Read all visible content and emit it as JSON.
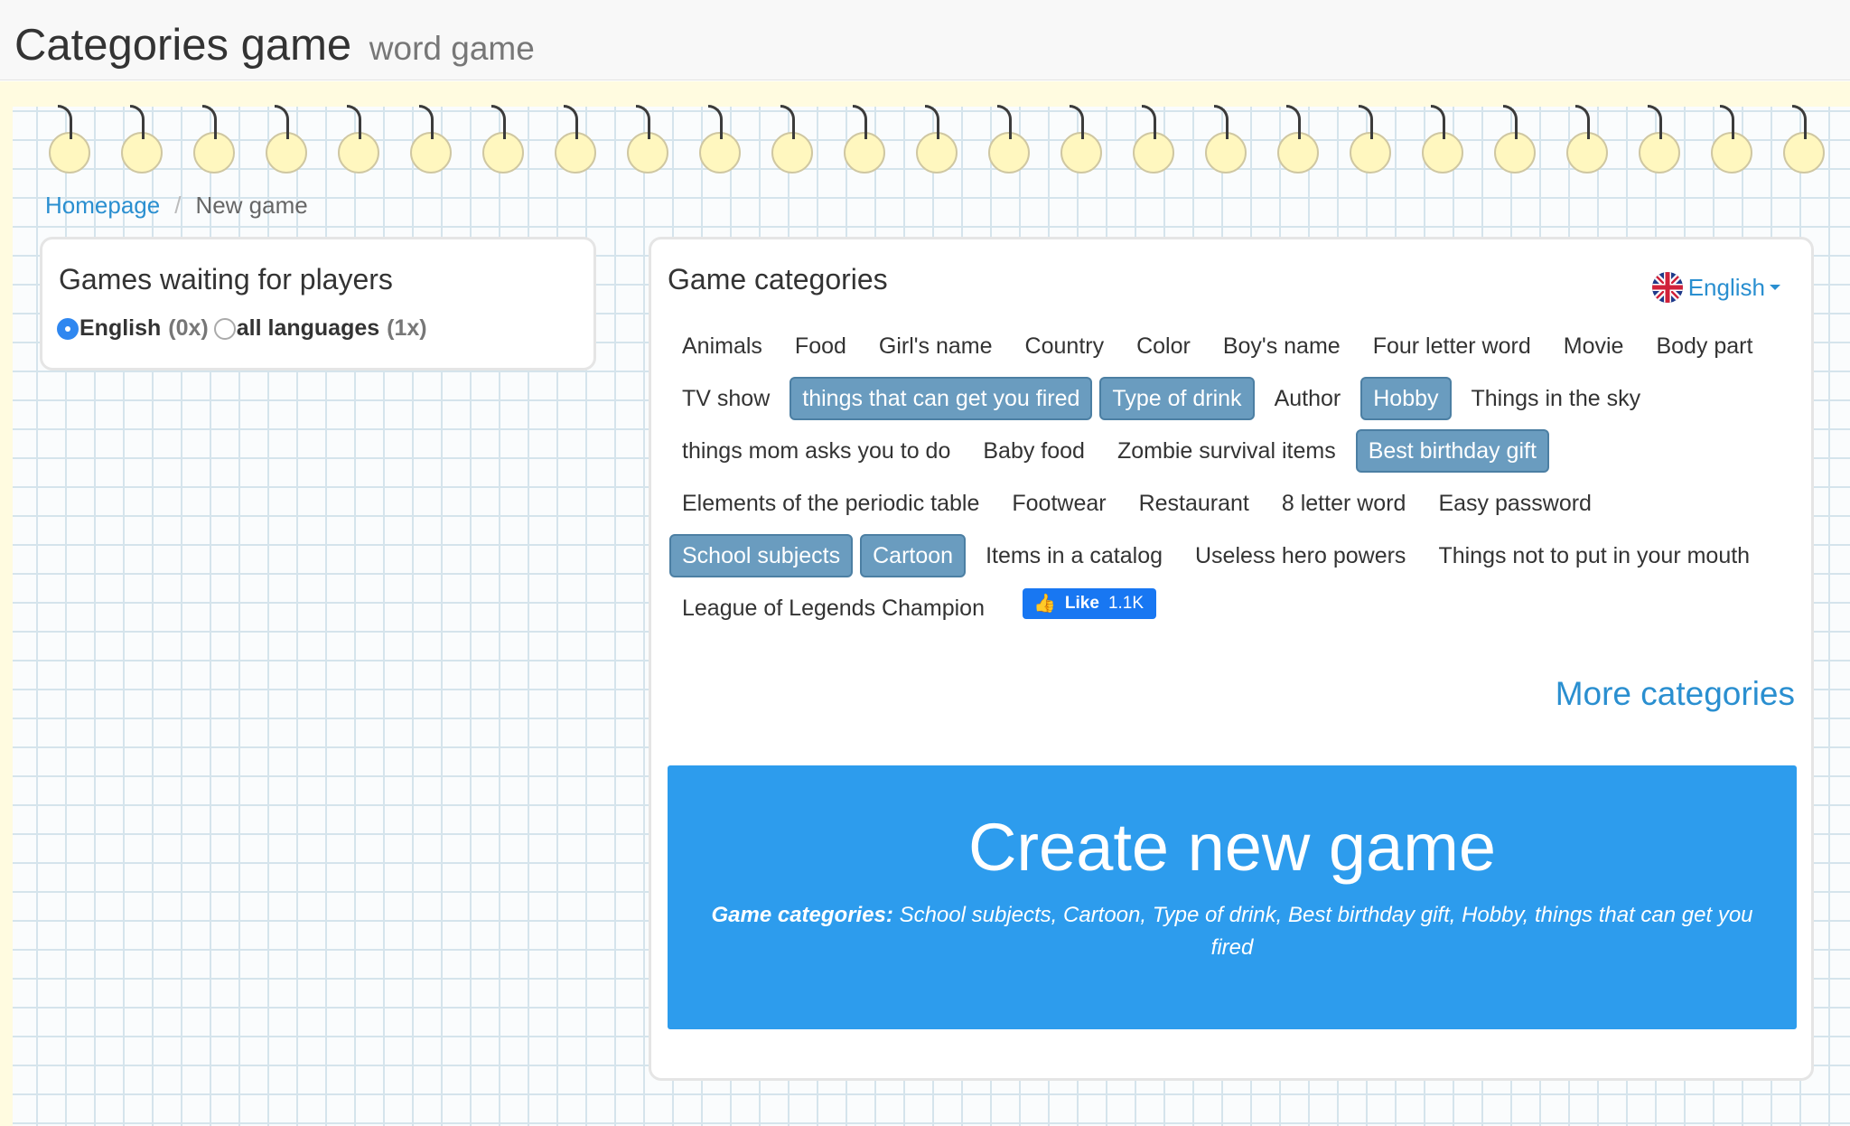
{
  "header": {
    "title": "Categories game",
    "subtitle": "word game"
  },
  "breadcrumb": {
    "home": "Homepage",
    "separator": "/",
    "current": "New game"
  },
  "waiting": {
    "title": "Games waiting for players",
    "options": [
      {
        "label": "English",
        "count": "(0x)",
        "checked": true
      },
      {
        "label": "all languages",
        "count": "(1x)",
        "checked": false
      }
    ]
  },
  "categories": {
    "title": "Game categories",
    "language": "English",
    "items": [
      {
        "label": "Animals",
        "selected": false
      },
      {
        "label": "Food",
        "selected": false
      },
      {
        "label": "Girl's name",
        "selected": false
      },
      {
        "label": "Country",
        "selected": false
      },
      {
        "label": "Color",
        "selected": false
      },
      {
        "label": "Boy's name",
        "selected": false
      },
      {
        "label": "Four letter word",
        "selected": false
      },
      {
        "label": "Movie",
        "selected": false
      },
      {
        "label": "Body part",
        "selected": false
      },
      {
        "label": "TV show",
        "selected": false
      },
      {
        "label": "things that can get you fired",
        "selected": true
      },
      {
        "label": "Type of drink",
        "selected": true
      },
      {
        "label": "Author",
        "selected": false
      },
      {
        "label": "Hobby",
        "selected": true
      },
      {
        "label": "Things in the sky",
        "selected": false
      },
      {
        "label": "things mom asks you to do",
        "selected": false
      },
      {
        "label": "Baby food",
        "selected": false
      },
      {
        "label": "Zombie survival items",
        "selected": false
      },
      {
        "label": "Best birthday gift",
        "selected": true
      },
      {
        "label": "Elements of the periodic table",
        "selected": false
      },
      {
        "label": "Footwear",
        "selected": false
      },
      {
        "label": "Restaurant",
        "selected": false
      },
      {
        "label": "8 letter word",
        "selected": false
      },
      {
        "label": "Easy password",
        "selected": false
      },
      {
        "label": "School subjects",
        "selected": true
      },
      {
        "label": "Cartoon",
        "selected": true
      },
      {
        "label": "Items in a catalog",
        "selected": false
      },
      {
        "label": "Useless hero powers",
        "selected": false
      },
      {
        "label": "Things not to put in your mouth",
        "selected": false
      },
      {
        "label": "League of Legends Champion",
        "selected": false
      }
    ],
    "like_label": "Like",
    "like_count": "1.1K",
    "more_label": "More categories"
  },
  "create": {
    "title": "Create new game",
    "categories_label": "Game categories:",
    "categories_value": "School subjects, Cartoon, Type of drink, Best birthday gift, Hobby, things that can get you fired"
  },
  "colors": {
    "accent": "#2a8fd0",
    "button": "#2d9ced",
    "tag_selected": "#6a9cbf",
    "facebook": "#1877f2"
  }
}
